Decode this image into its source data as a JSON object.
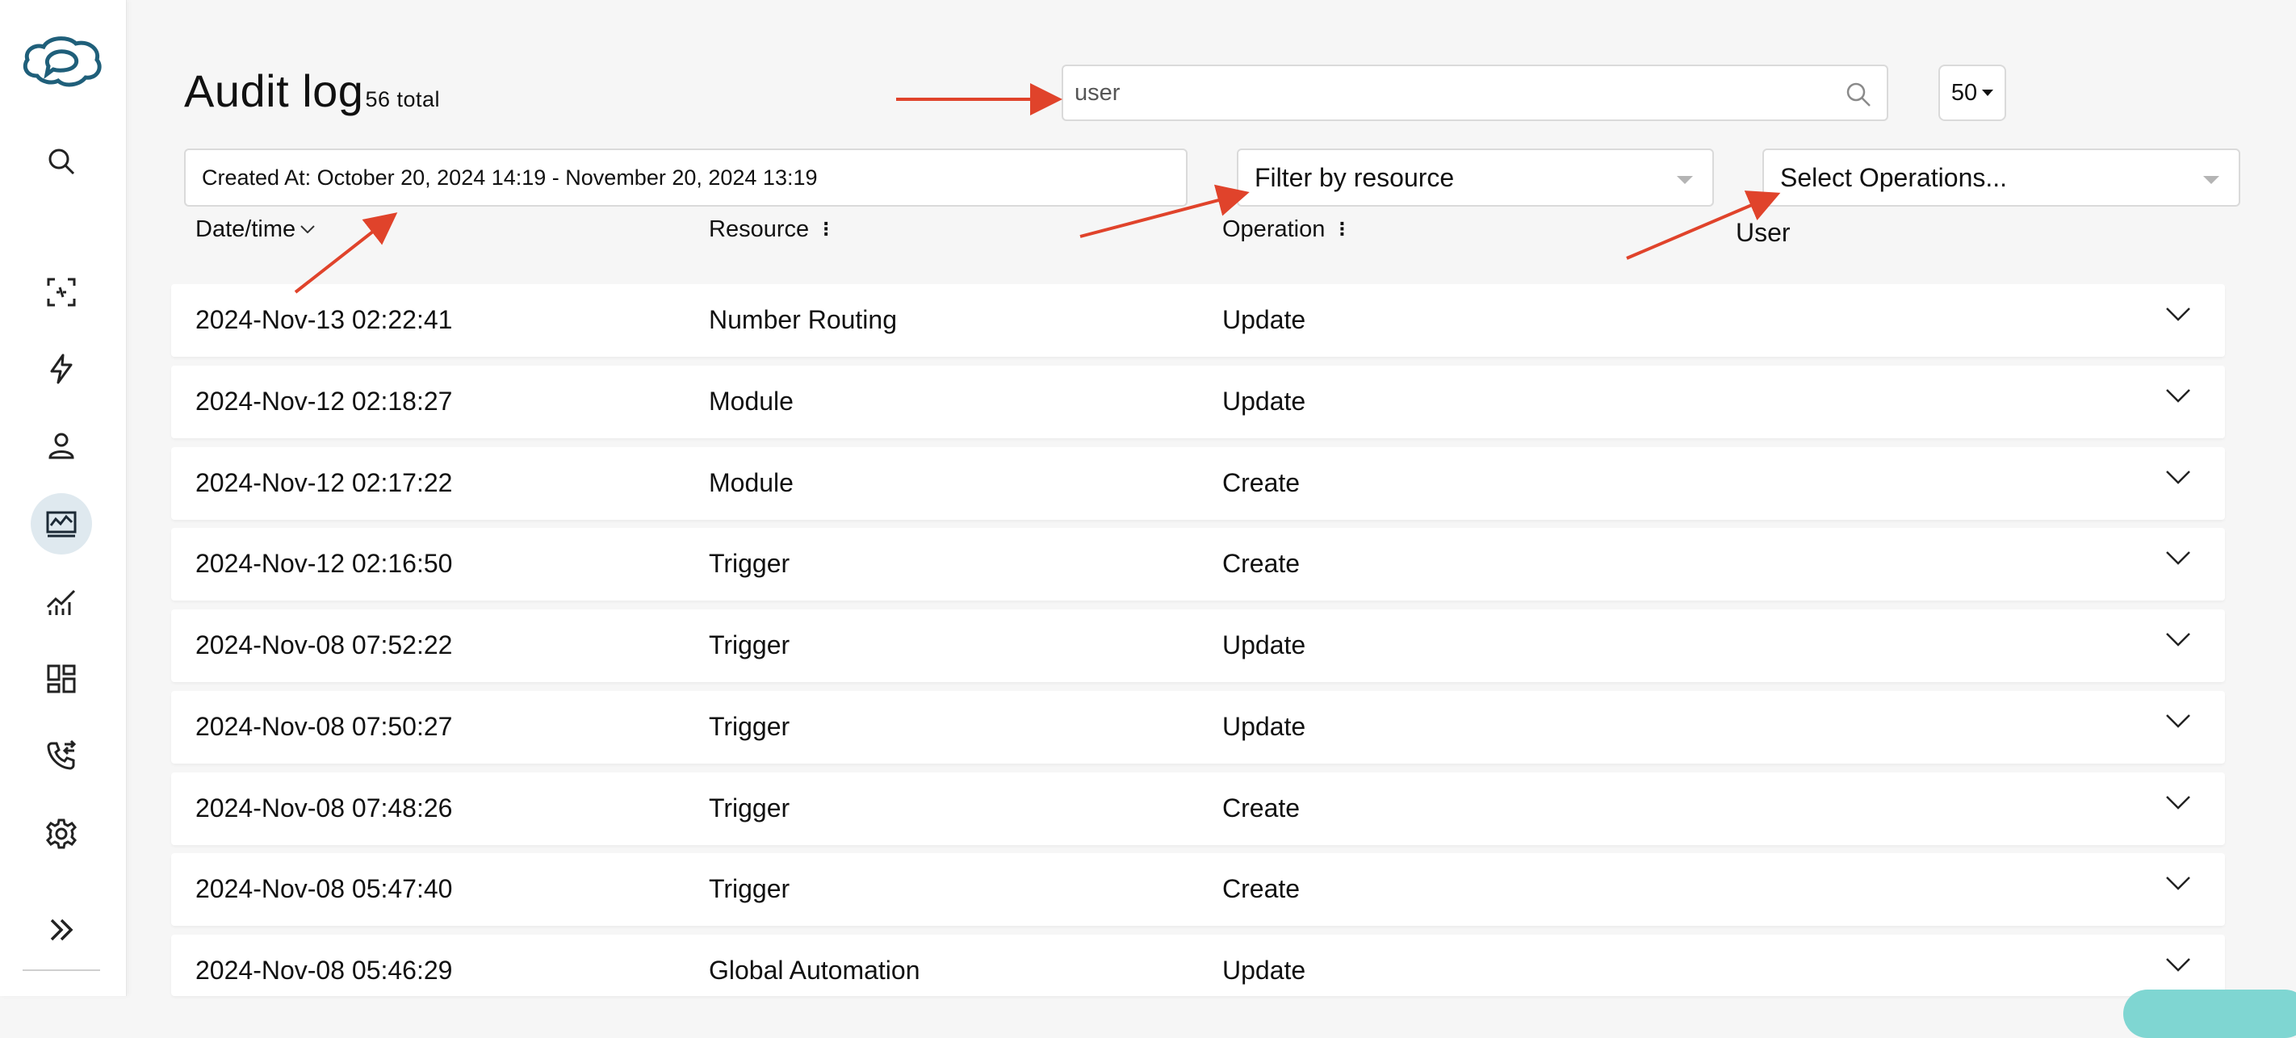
{
  "sidebar": {
    "logo": "cloud-chat-logo",
    "items": [
      {
        "icon": "search-icon"
      },
      {
        "icon": "scan-frame-icon"
      },
      {
        "icon": "lightning-icon"
      },
      {
        "icon": "user-icon"
      },
      {
        "icon": "monitor-activity-icon",
        "active": true
      },
      {
        "icon": "analytics-chart-icon"
      },
      {
        "icon": "dashboard-grid-icon"
      },
      {
        "icon": "phone-transfer-icon"
      },
      {
        "icon": "gear-icon"
      },
      {
        "icon": "expand-double-chevron-icon"
      }
    ]
  },
  "header": {
    "title": "Audit log",
    "total": "56 total"
  },
  "search": {
    "value": "user",
    "icon": "search-icon"
  },
  "page_size": {
    "value": "50"
  },
  "filters": {
    "created_at": "Created At: October 20, 2024 14:19 - November 20, 2024 13:19",
    "resource_placeholder": "Filter by resource",
    "operations_placeholder": "Select Operations..."
  },
  "columns": {
    "datetime": "Date/time",
    "resource": "Resource",
    "operation": "Operation",
    "user": "User"
  },
  "rows": [
    {
      "date": "2024-Nov-13 02:22:41",
      "resource": "Number Routing",
      "operation": "Update"
    },
    {
      "date": "2024-Nov-12 02:18:27",
      "resource": "Module",
      "operation": "Update"
    },
    {
      "date": "2024-Nov-12 02:17:22",
      "resource": "Module",
      "operation": "Create"
    },
    {
      "date": "2024-Nov-12 02:16:50",
      "resource": "Trigger",
      "operation": "Create"
    },
    {
      "date": "2024-Nov-08 07:52:22",
      "resource": "Trigger",
      "operation": "Update"
    },
    {
      "date": "2024-Nov-08 07:50:27",
      "resource": "Trigger",
      "operation": "Update"
    },
    {
      "date": "2024-Nov-08 07:48:26",
      "resource": "Trigger",
      "operation": "Create"
    },
    {
      "date": "2024-Nov-08 05:47:40",
      "resource": "Trigger",
      "operation": "Create"
    },
    {
      "date": "2024-Nov-08 05:46:29",
      "resource": "Global Automation",
      "operation": "Update"
    }
  ],
  "colors": {
    "accent": "#1f5f7a",
    "active_bg": "#dfe9ef",
    "annotation": "#e0432b"
  }
}
